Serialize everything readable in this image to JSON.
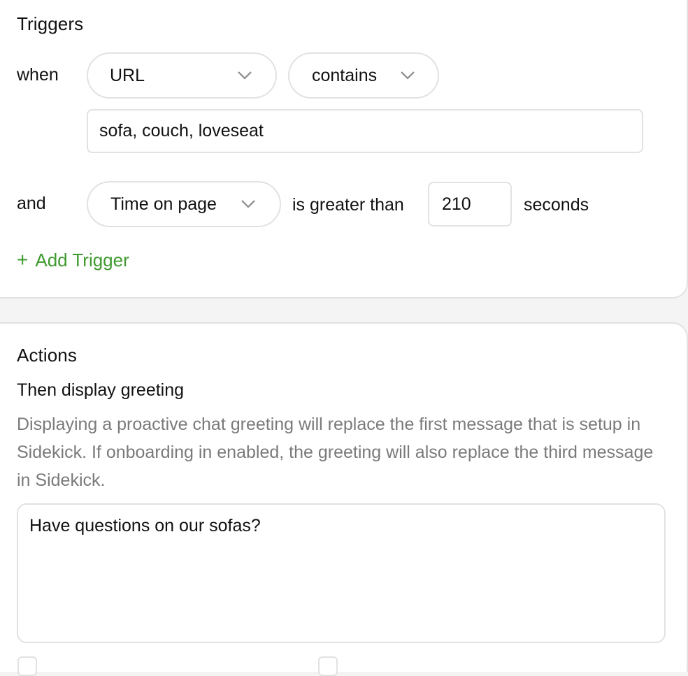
{
  "triggers": {
    "title": "Triggers",
    "condition1": {
      "prefix": "when",
      "field_select": {
        "value": "URL",
        "icon": "chevron-down-icon"
      },
      "operator_select": {
        "value": "contains",
        "icon": "chevron-down-icon"
      },
      "value_input": "sofa, couch, loveseat"
    },
    "condition2": {
      "prefix": "and",
      "field_select": {
        "value": "Time on page",
        "icon": "chevron-down-icon"
      },
      "operator_label": "is greater than",
      "value_input": "210",
      "unit_label": "seconds"
    },
    "add_trigger": {
      "icon": "plus-icon",
      "label": "Add Trigger",
      "color": "#3e9a2e"
    }
  },
  "actions": {
    "title": "Actions",
    "subheading": "Then display greeting",
    "description": "Displaying a proactive chat greeting will replace the first message that is setup in Sidekick. If onboarding in enabled, the greeting will also replace the third message in Sidekick.",
    "greeting_text": "Have questions on our sofas?"
  }
}
